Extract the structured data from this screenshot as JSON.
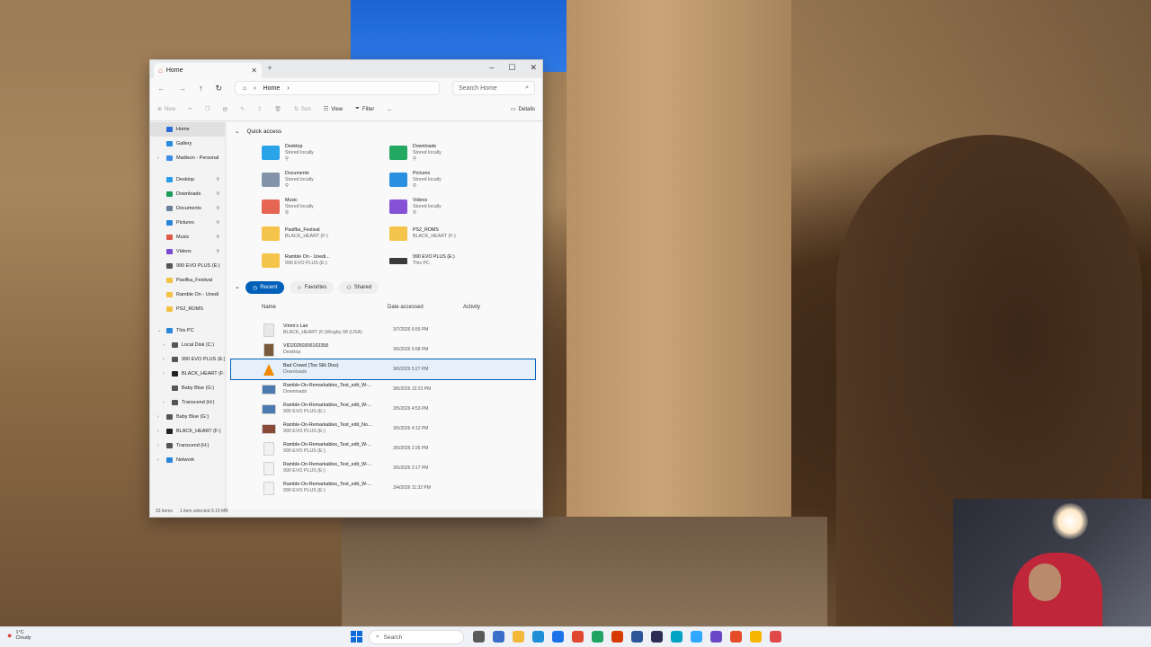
{
  "window": {
    "tab_title": "Home",
    "address_label": "Home",
    "search_placeholder": "Search Home"
  },
  "commandbar": {
    "new_label": "New",
    "sort_label": "Sort",
    "view_label": "View",
    "filter_label": "Filter",
    "more_label": "...",
    "details_label": "Details"
  },
  "nav": {
    "items": [
      {
        "label": "Home",
        "icon": "home-icon",
        "color": "#2b6cd6"
      },
      {
        "label": "Gallery",
        "icon": "gallery-icon",
        "color": "#2b8be0"
      },
      {
        "label": "Madison - Personal",
        "icon": "cloud-icon",
        "color": "#3e8ce8"
      },
      {
        "label": "Desktop",
        "icon": "desktop-icon",
        "color": "#2a9be6"
      },
      {
        "label": "Downloads",
        "icon": "download-icon",
        "color": "#1e9c5a"
      },
      {
        "label": "Documents",
        "icon": "document-icon",
        "color": "#6b7f99"
      },
      {
        "label": "Pictures",
        "icon": "pictures-icon",
        "color": "#2a86d8"
      },
      {
        "label": "Music",
        "icon": "music-icon",
        "color": "#e05848"
      },
      {
        "label": "Videos",
        "icon": "videos-icon",
        "color": "#7b4bd0"
      },
      {
        "label": "990 EVO PLUS (E:)",
        "icon": "drive-icon",
        "color": "#555"
      },
      {
        "label": "Pasifka_Festival",
        "icon": "folder-icon",
        "color": "#f2c245"
      },
      {
        "label": "Ramble On - Unedi",
        "icon": "folder-icon",
        "color": "#f2c245"
      },
      {
        "label": "PS2_ROMS",
        "icon": "folder-icon",
        "color": "#f2c245"
      },
      {
        "label": "This PC",
        "icon": "pc-icon",
        "color": "#2a86d8"
      },
      {
        "label": "Local Disk (C:)",
        "icon": "drive-icon",
        "color": "#555"
      },
      {
        "label": "990 EVO PLUS (E:)",
        "icon": "drive-icon",
        "color": "#555"
      },
      {
        "label": "BLACK_HEART (F:",
        "icon": "drive-icon",
        "color": "#222"
      },
      {
        "label": "Baby Blue (G:)",
        "icon": "drive-icon",
        "color": "#555"
      },
      {
        "label": "Transcend (H:)",
        "icon": "drive-icon",
        "color": "#555"
      },
      {
        "label": "Baby Blue (G:)",
        "icon": "drive-icon",
        "color": "#555"
      },
      {
        "label": "BLACK_HEART (F:)",
        "icon": "drive-icon",
        "color": "#222"
      },
      {
        "label": "Transcend (H:)",
        "icon": "drive-icon",
        "color": "#555"
      },
      {
        "label": "Network",
        "icon": "network-icon",
        "color": "#2a86d8"
      }
    ]
  },
  "quick_access": {
    "header": "Quick access",
    "items": [
      {
        "name": "Desktop",
        "sub": "Stored locally",
        "icon": "desktop-folder-icon",
        "color": "#2aa3e8"
      },
      {
        "name": "Downloads",
        "sub": "Stored locally",
        "icon": "downloads-folder-icon",
        "color": "#23a862"
      },
      {
        "name": "Documents",
        "sub": "Stored locally",
        "icon": "documents-folder-icon",
        "color": "#8293aa"
      },
      {
        "name": "Pictures",
        "sub": "Stored locally",
        "icon": "pictures-folder-icon",
        "color": "#2b8fe0"
      },
      {
        "name": "Music",
        "sub": "Stored locally",
        "icon": "music-folder-icon",
        "color": "#e66452"
      },
      {
        "name": "Videos",
        "sub": "Stored locally",
        "icon": "videos-folder-icon",
        "color": "#8552d6"
      },
      {
        "name": "Pasifka_Festival",
        "sub": "BLACK_HEART (F:)",
        "icon": "folder-icon",
        "color": "#f4c54a"
      },
      {
        "name": "PS2_ROMS",
        "sub": "BLACK_HEART (F:)",
        "icon": "folder-icon",
        "color": "#f4c54a"
      },
      {
        "name": "Ramble On - Unedi...",
        "sub": "990 EVO PLUS (E:)",
        "icon": "folder-icon",
        "color": "#f4c54a"
      },
      {
        "name": "990 EVO PLUS (E:)",
        "sub": "This PC",
        "icon": "drive-icon",
        "color": "#3a3a3a"
      }
    ]
  },
  "pills": {
    "recent": "Recent",
    "favorites": "Favorites",
    "shared": "Shared"
  },
  "columns": {
    "name": "Name",
    "date": "Date accessed",
    "activity": "Activity"
  },
  "files": [
    {
      "name": "Vimm's Lair",
      "sub": "BLACK_HEART (F:)\\Rugby 08 (USA)",
      "date": "3/7/2026 6:55 PM",
      "icon": "file-icon",
      "color": "#e8e8e8"
    },
    {
      "name": "VID20260306163358",
      "sub": "Desktop",
      "date": "3/6/2026 5:58 PM",
      "icon": "video-file-icon",
      "color": "#7a5a3a"
    },
    {
      "name": "Bad Crowd (Too Slik Diss)",
      "sub": "Downloads",
      "date": "3/6/2026 5:27 PM",
      "icon": "vlc-icon",
      "color": "#f08a00"
    },
    {
      "name": "Ramble-On-Remarkables_Test_edit_W-...",
      "sub": "Downloads",
      "date": "3/6/2026 12:23 PM",
      "icon": "image-file-icon",
      "color": "#4a7ab0"
    },
    {
      "name": "Ramble-On-Remarkables_Test_edit_W-...",
      "sub": "990 EVO PLUS (E:)",
      "date": "3/5/2026 4:53 PM",
      "icon": "image-file-icon",
      "color": "#4a7ab0"
    },
    {
      "name": "Ramble-On-Remarkables_Test_edit_No...",
      "sub": "990 EVO PLUS (E:)",
      "date": "3/5/2026 4:12 PM",
      "icon": "image-file-icon",
      "color": "#8a4a3a"
    },
    {
      "name": "Ramble-On-Remarkables_Test_edit_W-...",
      "sub": "990 EVO PLUS (E:)",
      "date": "3/5/2026 2:26 PM",
      "icon": "file-icon",
      "color": "#f2f2f2"
    },
    {
      "name": "Ramble-On-Remarkables_Test_edit_W-...",
      "sub": "990 EVO PLUS (E:)",
      "date": "3/5/2026 2:17 PM",
      "icon": "file-icon",
      "color": "#f2f2f2"
    },
    {
      "name": "Ramble-On-Remarkables_Test_edit_W-...",
      "sub": "990 EVO PLUS (E:)",
      "date": "3/4/2026 11:32 PM",
      "icon": "file-icon",
      "color": "#f2f2f2"
    }
  ],
  "status": {
    "count": "33 items",
    "selection": "1 item selected  9.19 MB"
  },
  "taskbar": {
    "temperature": "1°C",
    "weather": "Cloudy",
    "search_label": "Search",
    "app_colors": [
      "#5a5a5a",
      "#3a6fc9",
      "#f3b73a",
      "#1f8fd8",
      "#1a73e8",
      "#e0472f",
      "#1fa463",
      "#d83b01",
      "#2b579a",
      "#2c2c54",
      "#00a3c4",
      "#31a8ff",
      "#6a47c4",
      "#e34c26",
      "#f7b500",
      "#e0484a"
    ]
  }
}
